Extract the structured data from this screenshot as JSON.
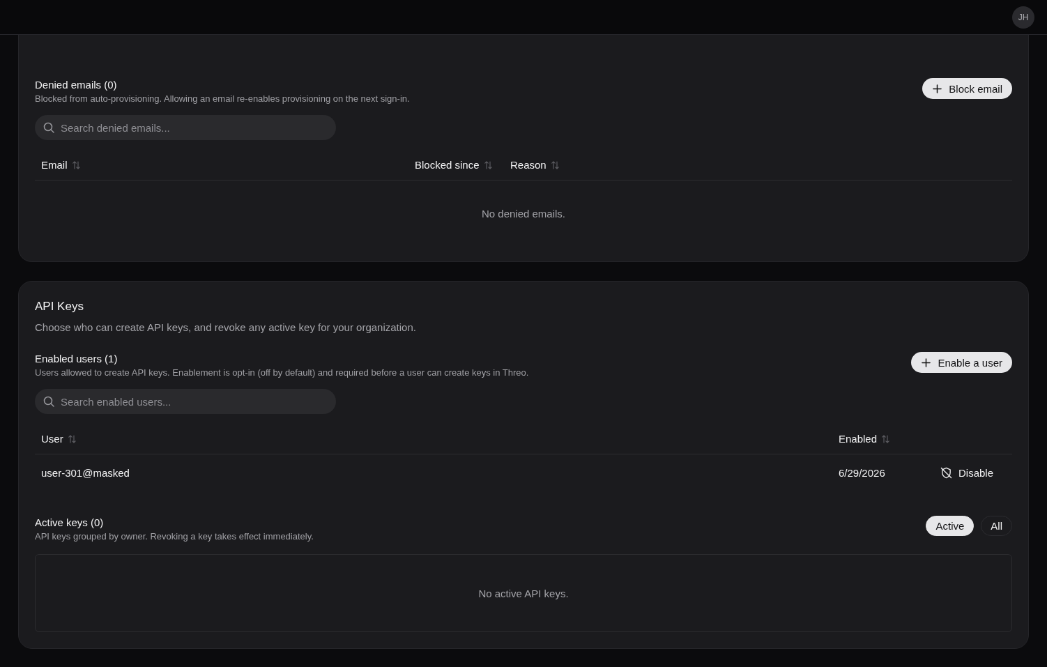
{
  "top_bar": {
    "avatar": "JH"
  },
  "denied_emails": {
    "title": "Denied emails (0)",
    "description": "Blocked from auto-provisioning. Allowing an email re-enables provisioning on the next sign-in.",
    "button": "Block email",
    "search": {
      "placeholder": "Search denied emails..."
    },
    "columns": [
      {
        "label": "Email",
        "sortable": true
      },
      {
        "label": "Blocked since",
        "sortable": true
      },
      {
        "label": "Reason",
        "sortable": true
      }
    ],
    "empty_message": "No denied emails."
  },
  "api_keys": {
    "title": "API Keys",
    "description": "Choose who can create API keys, and revoke any active key for your organization.",
    "enabled_users": {
      "title": "Enabled users (1)",
      "description": "Users allowed to create API keys. Enablement is opt-in (off by default) and required before a user can create keys in Threo.",
      "button": "Enable a user",
      "search": {
        "placeholder": "Search enabled users..."
      },
      "columns": [
        {
          "label": "User",
          "sortable": true
        },
        {
          "label": "Enabled",
          "sortable": true
        }
      ],
      "rows": [
        {
          "user": "user-301@masked",
          "enabled": "6/29/2026",
          "action": "Disable"
        }
      ]
    },
    "active_keys": {
      "title": "Active keys (0)",
      "description": "API keys grouped by owner. Revoking a key takes effect immediately.",
      "filters": [
        {
          "label": "Active",
          "selected": true
        },
        {
          "label": "All",
          "selected": false
        }
      ],
      "empty_message": "No active API keys."
    }
  }
}
